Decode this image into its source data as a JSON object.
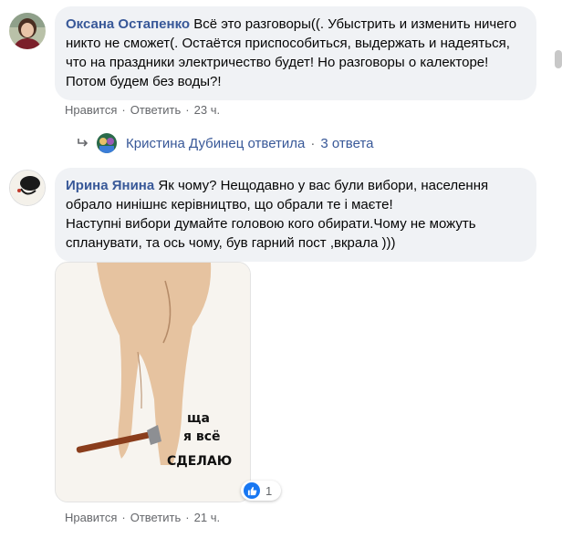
{
  "comments": [
    {
      "author": "Оксана Остапенко",
      "text": "Всё это разговоры((. Убыстрить и изменить ничего никто не сможет(. Остаётся приспособиться, выдержать и надеяться, что на праздники электричество будет! Но разговоры о калекторе! Потом будем без воды?!",
      "like_label": "Нравится",
      "reply_label": "Ответить",
      "time": "23 ч.",
      "replies_summary": {
        "name": "Кристина Дубинец",
        "verb": "ответила",
        "count_label": "3 ответа"
      }
    },
    {
      "author": "Ирина Янина",
      "text_line1": "Як чому? Нещодавно у вас були вибори, населення обрало нинішнє керівництво, що обрали те і маєте!",
      "text_line2": "Наступні вибори думайте головою кого обирати.Чому не можуть спланувати, та ось чому, був гарний пост ,вкрала )))",
      "image_caption": [
        "ща",
        "я всё",
        "СДЕЛАЮ"
      ],
      "reaction_count": "1",
      "like_label": "Нравится",
      "reply_label": "Ответить",
      "time": "21 ч."
    }
  ],
  "colors": {
    "author_link": "#385898",
    "bubble_bg": "#f0f2f5",
    "meta_text": "#65676b",
    "like_blue": "#1877f2"
  },
  "icons": {
    "reply_arrow": "reply-arrow-icon",
    "like": "thumbs-up-icon"
  }
}
